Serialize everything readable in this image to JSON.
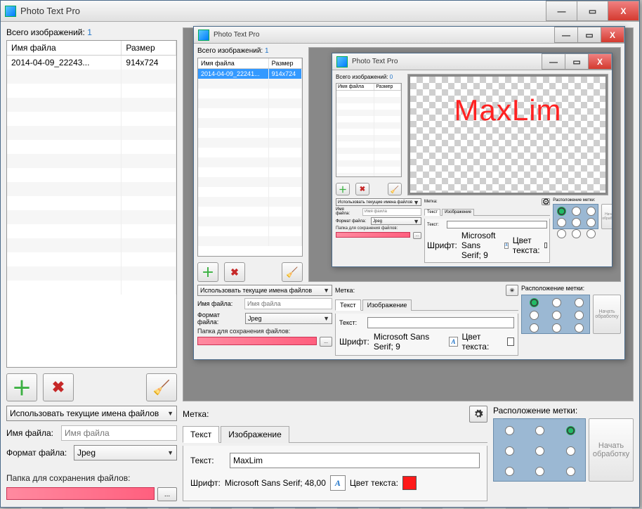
{
  "app": {
    "title": "Photo Text Pro"
  },
  "win": {
    "min": "—",
    "max": "▭",
    "close": "X"
  },
  "leftpane": {
    "count_label": "Всего изображений:",
    "count_value": "1",
    "col_name": "Имя файла",
    "col_size": "Размер",
    "row_name": "2014-04-09_22243...",
    "row_size": "914x724"
  },
  "toolbar": {
    "add": "+",
    "del": "✖",
    "clear": ""
  },
  "options": {
    "naming_mode": "Использовать текущие имена файлов",
    "filename_label": "Имя файла:",
    "filename_placeholder": "Имя файла",
    "format_label": "Формат файла:",
    "format_value": "Jpeg",
    "folder_label": "Папка для сохранения файлов:",
    "folder_btn": "..."
  },
  "label_section": {
    "title": "Метка:",
    "tab_text": "Текст",
    "tab_image": "Изображение",
    "text_label": "Текст:",
    "text_value": "MaxLim",
    "font_label": "Шрифт:",
    "font_value": "Microsoft Sans Serif; 48,00",
    "color_label": "Цвет текста:",
    "color_value": "#ff1a1a"
  },
  "position": {
    "title": "Расположение метки:",
    "selected": "top-right"
  },
  "start_btn": "Начать обработку",
  "nested1": {
    "leftpane": {
      "count_value": "1",
      "row_name": "2014-04-09_22241...",
      "row_size": "914x724"
    },
    "options": {
      "format_value": "Jpeg"
    },
    "label_section": {
      "text_value": "",
      "font_value": "Microsoft Sans Serif; 9",
      "color_value": "#ffffff"
    }
  },
  "nested2": {
    "leftpane": {
      "count_value": "0"
    },
    "options": {
      "format_value": "Jpeg"
    },
    "label_section": {
      "text_value": "",
      "font_value": "Microsoft Sans Serif; 9",
      "color_value": "#ffffff"
    },
    "watermark": "MaxLim"
  }
}
